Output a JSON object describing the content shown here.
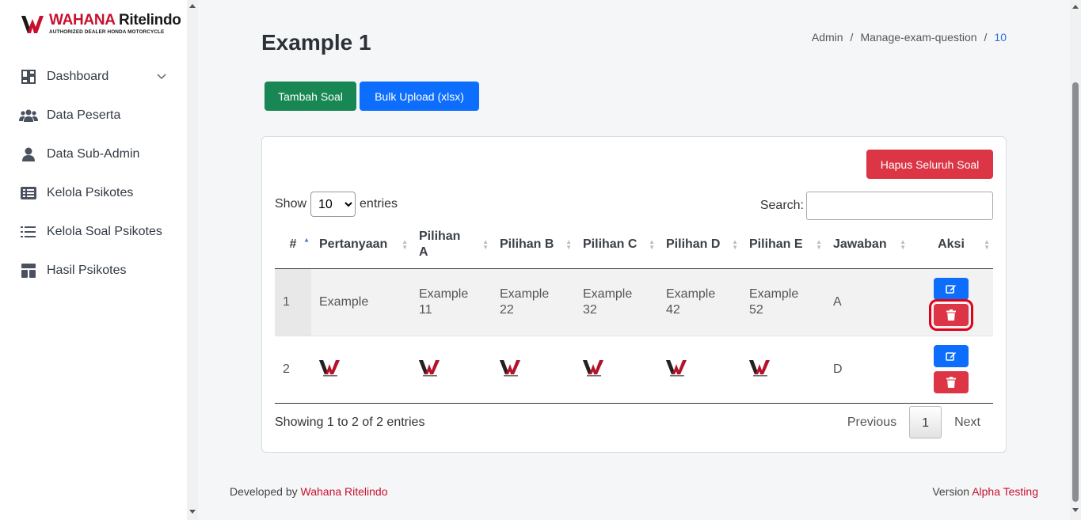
{
  "brand": {
    "name_part1": "WAHANA",
    "name_part2": "Ritelindo",
    "tagline": "AUTHORIZED DEALER HONDA MOTORCYCLE"
  },
  "sidebar": {
    "items": [
      {
        "label": "Dashboard",
        "icon": "dashboard-icon",
        "has_chevron": true
      },
      {
        "label": "Data Peserta",
        "icon": "users-icon"
      },
      {
        "label": "Data Sub-Admin",
        "icon": "user-icon"
      },
      {
        "label": "Kelola Psikotes",
        "icon": "list-alt-icon"
      },
      {
        "label": "Kelola Soal Psikotes",
        "icon": "list-icon"
      },
      {
        "label": "Hasil Psikotes",
        "icon": "layout-icon"
      }
    ]
  },
  "page": {
    "title": "Example 1"
  },
  "breadcrumb": {
    "items": [
      "Admin",
      "/",
      "Manage-exam-question",
      "/",
      "10"
    ]
  },
  "actions": {
    "add_label": "Tambah Soal",
    "upload_label": "Bulk Upload (xlsx)",
    "delete_all_label": "Hapus Seluruh Soal"
  },
  "table_controls": {
    "show_label": "Show",
    "entries_value": "10",
    "entries_label": "entries",
    "search_label": "Search:"
  },
  "table": {
    "headers": [
      "#",
      "Pertanyaan",
      "Pilihan A",
      "Pilihan B",
      "Pilihan C",
      "Pilihan D",
      "Pilihan E",
      "Jawaban",
      "Aksi"
    ],
    "rows": [
      {
        "no": "1",
        "pertanyaan": "Example",
        "a": "Example 11",
        "b": "Example 22",
        "c": "Example 32",
        "d": "Example 42",
        "e": "Example 52",
        "jawaban": "A"
      },
      {
        "no": "2",
        "pertanyaan": "image",
        "a": "image",
        "b": "image",
        "c": "image",
        "d": "image",
        "e": "image",
        "jawaban": "D"
      }
    ]
  },
  "pagination": {
    "info": "Showing 1 to 2 of 2 entries",
    "previous": "Previous",
    "current": "1",
    "next": "Next"
  },
  "footer": {
    "left_prefix": "Developed by",
    "left_link": "Wahana Ritelindo",
    "right_prefix": "Version",
    "right_link": "Alpha Testing"
  },
  "colors": {
    "success": "#198754",
    "primary": "#0d6efd",
    "danger": "#dc3545",
    "brand_red": "#c8102e"
  }
}
